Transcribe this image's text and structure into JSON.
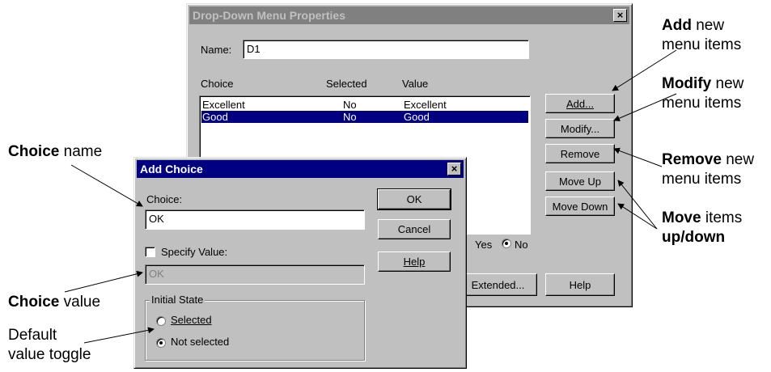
{
  "main_dialog": {
    "title": "Drop-Down Menu Properties",
    "close_label": "×",
    "name_label": "Name:",
    "name_value": "D1",
    "columns": [
      "Choice",
      "Selected",
      "Value"
    ],
    "rows": [
      {
        "choice": "Excellent",
        "selected": "No",
        "value": "Excellent"
      },
      {
        "choice": "Good",
        "selected": "No",
        "value": "Good"
      }
    ],
    "buttons": {
      "add": "Add...",
      "modify": "Modify...",
      "remove": "Remove",
      "move_up": "Move Up",
      "move_down": "Move Down",
      "extended": "Extended...",
      "help": "Help"
    },
    "radio_yes": "Yes",
    "radio_no": "No"
  },
  "add_choice_dialog": {
    "title": "Add Choice",
    "close_label": "×",
    "choice_label": "Choice:",
    "choice_value": "OK",
    "specify_value_label": "Specify Value:",
    "value_field": "OK",
    "initial_state_label": "Initial State",
    "radio_selected": "Selected",
    "radio_not_selected": "Not selected",
    "ok": "OK",
    "cancel": "Cancel",
    "help": "Help"
  },
  "annotations": {
    "add": {
      "bold": "Add",
      "rest": " new",
      "line2": "menu items"
    },
    "modify": {
      "bold": "Modify",
      "rest": " new",
      "line2": "menu items"
    },
    "remove": {
      "bold": "Remove",
      "rest": " new",
      "line2": "menu items"
    },
    "move": {
      "bold": "Move",
      "rest": " items",
      "line2": "up/down"
    },
    "choice_name": {
      "bold": "Choice",
      "rest": " name"
    },
    "choice_value": {
      "bold": "Choice",
      "rest": " value"
    },
    "default_toggle": {
      "line1": "Default",
      "line2": "value toggle"
    }
  }
}
